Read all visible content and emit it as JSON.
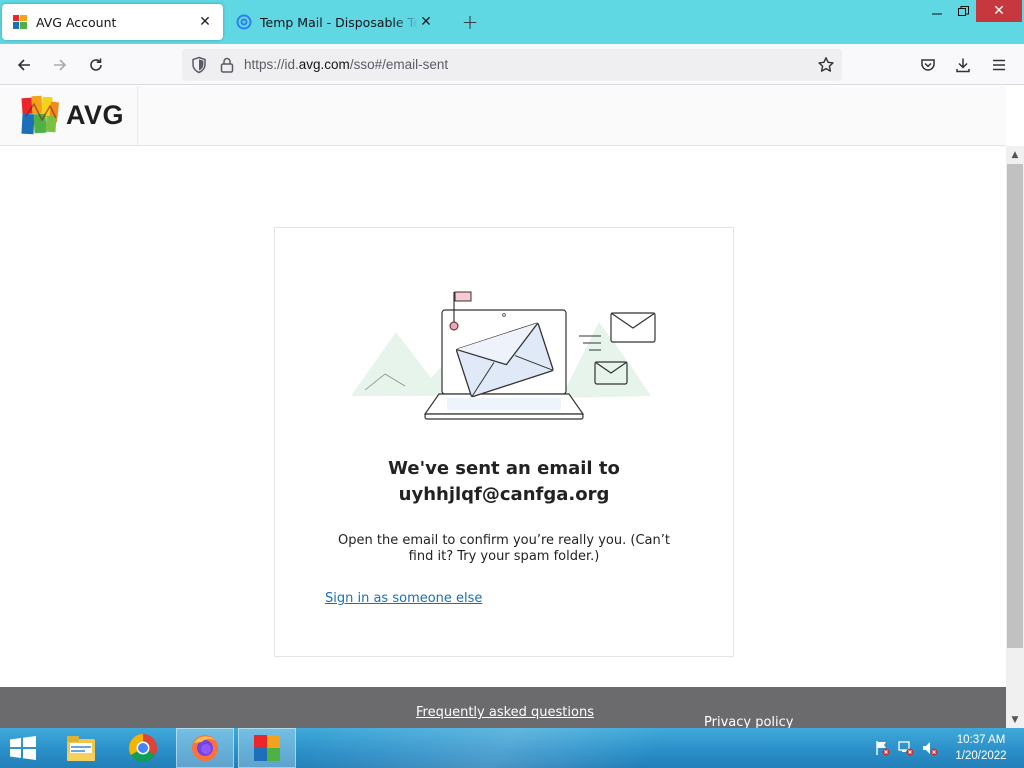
{
  "browser": {
    "tabs": [
      {
        "title": "AVG Account",
        "active": true
      },
      {
        "title": "Temp Mail - Disposable Temporary Email",
        "active": false
      }
    ],
    "url_prefix": "https://id.",
    "url_domain": "avg.com",
    "url_path": "/sso#/email-sent"
  },
  "page": {
    "brand": "AVG",
    "heading_line1": "We've sent an email to",
    "heading_line2": "uyhhjlqf@canfga.org",
    "message": "Open the email to confirm you’re really you. (Can’t find it? Try your spam folder.)",
    "sign_in_link": "Sign in as someone else",
    "footer_faq": "Frequently asked questions",
    "footer_privacy": "Privacy policy"
  },
  "taskbar": {
    "apps": [
      "file-explorer",
      "chrome",
      "firefox",
      "avg"
    ],
    "time": "10:37 AM",
    "date": "1/20/2022"
  },
  "colors": {
    "tabbar": "#5fd8e3",
    "link": "#1b6fb5",
    "footer": "#6b6b6e",
    "window_close": "#c7373e"
  }
}
